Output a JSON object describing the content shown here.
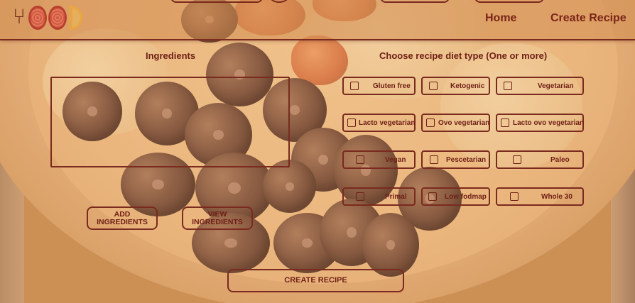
{
  "nav": {
    "home": "Home",
    "create_recipe": "Create Recipe"
  },
  "ingredients": {
    "title": "Ingredients",
    "add_button": "ADD INGREDIENTS",
    "view_button": "VIEW INGREDIENTS"
  },
  "diet": {
    "title": "Choose recipe diet type (One or more)",
    "options": [
      {
        "label": "Gluten free",
        "checked": false
      },
      {
        "label": "Ketogenic",
        "checked": false
      },
      {
        "label": "Vegetarian",
        "checked": false
      },
      {
        "label": "Lacto vegetarian",
        "checked": false
      },
      {
        "label": "Ovo vegetarian",
        "checked": false
      },
      {
        "label": "Lacto ovo vegetarian",
        "checked": false
      },
      {
        "label": "Vegan",
        "checked": false
      },
      {
        "label": "Pescetarian",
        "checked": false
      },
      {
        "label": "Paleo",
        "checked": false
      },
      {
        "label": "Primal",
        "checked": false
      },
      {
        "label": "Low fodmap",
        "checked": false
      },
      {
        "label": "Whole 30",
        "checked": false
      }
    ]
  },
  "create_button": "CREATE RECIPE",
  "colors": {
    "accent": "#7a2a1e",
    "text": "#6f2016",
    "header_bg": "#d28c50"
  },
  "icons": {
    "logo": "food-logo-icon"
  }
}
